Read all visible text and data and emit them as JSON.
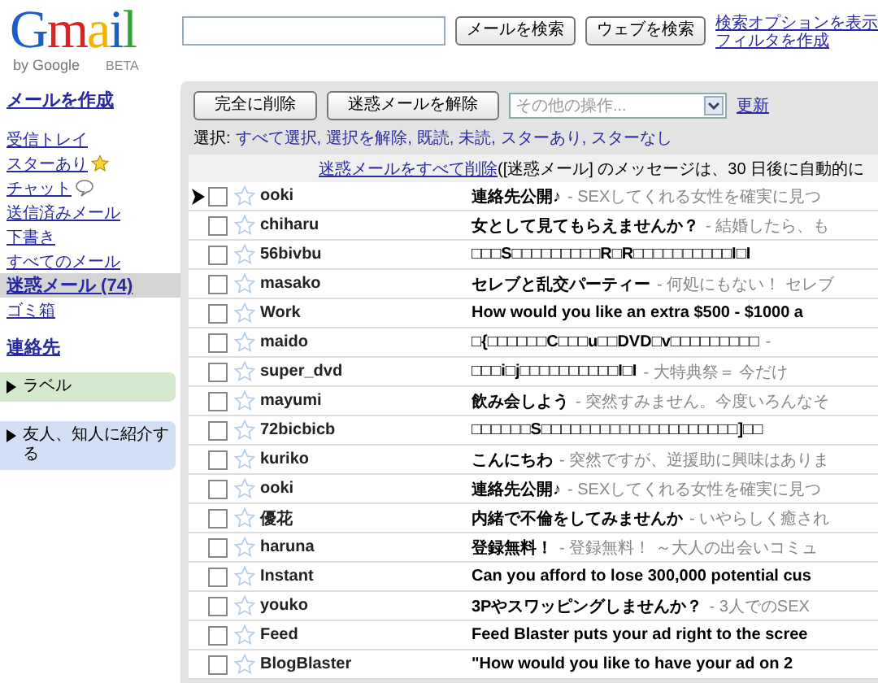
{
  "logo": {
    "letters": [
      "G",
      "m",
      "a",
      "i",
      "l"
    ],
    "byline": "by Google",
    "badge": "BETA"
  },
  "search": {
    "buttons": [
      "メールを検索",
      "ウェブを検索"
    ],
    "links": [
      "検索オプションを表示",
      "フィルタを作成"
    ]
  },
  "sidebar": {
    "compose": "メールを作成",
    "items": [
      {
        "label": "受信トレイ",
        "kind": "plain",
        "selected": false
      },
      {
        "label": "スターあり",
        "kind": "starred",
        "selected": false
      },
      {
        "label": "チャット",
        "kind": "chat",
        "selected": false
      },
      {
        "label": "送信済みメール",
        "kind": "plain",
        "selected": false
      },
      {
        "label": "下書き",
        "kind": "plain",
        "selected": false
      },
      {
        "label": "すべてのメール",
        "kind": "plain",
        "selected": false
      },
      {
        "label": "迷惑メール (74)",
        "kind": "plain",
        "selected": true
      },
      {
        "label": "ゴミ箱",
        "kind": "plain",
        "selected": false
      }
    ],
    "contacts": "連絡先",
    "boxes": [
      {
        "label": "ラベル",
        "color": "#d3e8cc"
      },
      {
        "label": "友人、知人に紹介する",
        "color": "#d2dff4"
      }
    ]
  },
  "toolbar": {
    "buttons": [
      "完全に削除",
      "迷惑メールを解除"
    ],
    "more_actions": {
      "placeholder": "その他の操作..."
    },
    "refresh": "更新",
    "select_label": "選択:",
    "select_links": [
      "すべて選択,",
      "選択を解除,",
      "既読,",
      "未読,",
      "スターあり,",
      "スターなし"
    ],
    "notice_link": "迷惑メールをすべて削除",
    "notice_text": "([迷惑メール] のメッセージは、30 日後に自動的に"
  },
  "messages": [
    {
      "sender": "ooki",
      "subject": "連絡先公開♪",
      "snippet": "- SEXしてくれる女性を確実に見つ",
      "current": true,
      "checked": false,
      "starred": false
    },
    {
      "sender": "chiharu",
      "subject": "女として見てもらえませんか？",
      "snippet": "- 結婚したら、も",
      "current": false,
      "checked": false,
      "starred": false
    },
    {
      "sender": "56bivbu",
      "subject": "□□□S□□□□□□□□□R□R□□□□□□□□□□I□I",
      "current": false,
      "checked": false,
      "starred": false
    },
    {
      "sender": "masako",
      "subject": "セレブと乱交パーティー",
      "snippet": "- 何処にもない！ セレブ",
      "current": false,
      "checked": false,
      "starred": false
    },
    {
      "sender": "Work",
      "subject": "How would you like an extra $500 - $1000 a",
      "current": false,
      "checked": false,
      "starred": false
    },
    {
      "sender": "maido",
      "subject": "□{□□□□□□C□□□u□□DVD□v□□□□□□□□□",
      "snippet": "-",
      "current": false,
      "checked": false,
      "starred": false
    },
    {
      "sender": "super_dvd",
      "subject": "□□□i□j□□□□□□□□□□I□I",
      "snippet": "- 大特典祭＝ 今だけ",
      "current": false,
      "checked": false,
      "starred": false
    },
    {
      "sender": "mayumi",
      "subject": "飲み会しよう",
      "snippet": "- 突然すみません。今度いろんなそ",
      "current": false,
      "checked": false,
      "starred": false
    },
    {
      "sender": "72bicbicb",
      "subject": "□□□□□□S□□□□□□□□□□□□□□□□□□□□]□□",
      "current": false,
      "checked": false,
      "starred": false
    },
    {
      "sender": "kuriko",
      "subject": "こんにちわ",
      "snippet": "- 突然ですが、逆援助に興味はありま",
      "current": false,
      "checked": false,
      "starred": false
    },
    {
      "sender": "ooki",
      "subject": "連絡先公開♪",
      "snippet": "- SEXしてくれる女性を確実に見つ",
      "current": false,
      "checked": false,
      "starred": false
    },
    {
      "sender": "優花",
      "subject": "内緒で不倫をしてみませんか",
      "snippet": "- いやらしく癒され",
      "current": false,
      "checked": false,
      "starred": false
    },
    {
      "sender": "haruna",
      "subject": "登録無料！",
      "snippet": "- 登録無料！ ～大人の出会いコミュ",
      "current": false,
      "checked": false,
      "starred": false
    },
    {
      "sender": "Instant",
      "subject": "Can you afford to lose 300,000 potential cus",
      "current": false,
      "checked": false,
      "starred": false
    },
    {
      "sender": "youko",
      "subject": "3Pやスワッピングしませんか？",
      "snippet": "- 3人でのSEX",
      "current": false,
      "checked": false,
      "starred": false
    },
    {
      "sender": "Feed",
      "subject": "Feed Blaster puts your ad right to the scree",
      "current": false,
      "checked": false,
      "starred": false
    },
    {
      "sender": "BlogBlaster",
      "subject": "\"How would you like to have your ad on 2",
      "current": false,
      "checked": false,
      "starred": false
    }
  ]
}
